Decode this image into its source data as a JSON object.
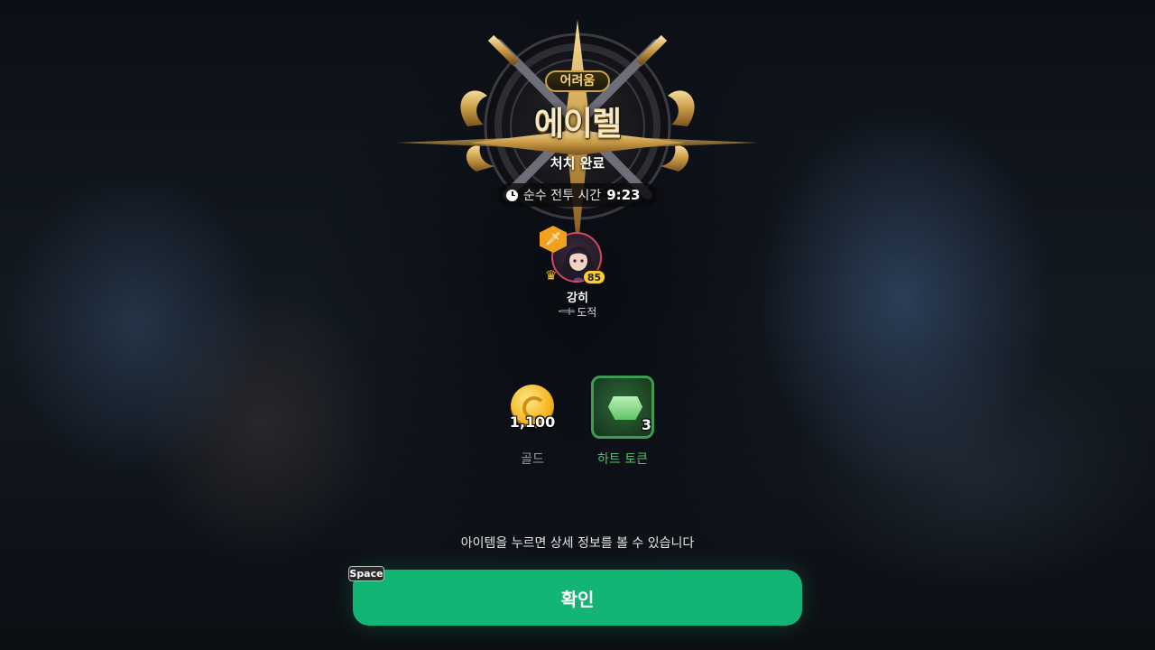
{
  "boss": {
    "difficulty": "어려움",
    "name": "에이렐",
    "status": "처치 완료",
    "timer_label": "순수 전투 시간",
    "timer_value": "9:23"
  },
  "player": {
    "level": "85",
    "name": "강히",
    "class": "도적",
    "weapon_badge_icon": "sword-icon",
    "crown_icon": "crown-icon"
  },
  "rewards": [
    {
      "icon": "gold-coin-icon",
      "amount": "1,100",
      "label": "골드",
      "label_color": "#9a9a9a"
    },
    {
      "icon": "heart-token-icon",
      "amount": "3",
      "label": "하트 토큰",
      "label_color": "#4fc16a"
    }
  ],
  "hint": "아이템을 누르면 상세 정보를 볼 수 있습니다",
  "confirm": {
    "label": "확인",
    "shortcut": "Space",
    "color": "#12b574"
  }
}
